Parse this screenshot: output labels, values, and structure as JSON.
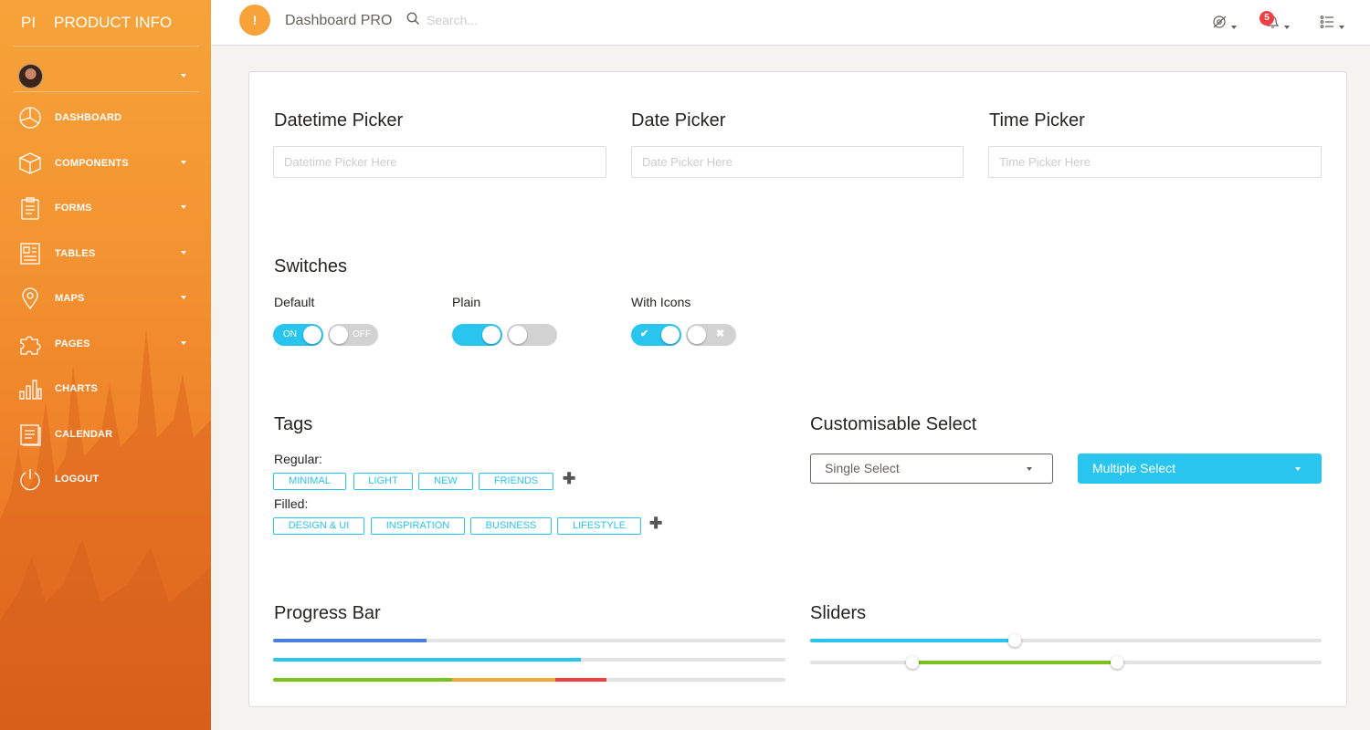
{
  "sidebar": {
    "logo_mini": "PI",
    "logo_full": "PRODUCT INFO",
    "items": [
      {
        "label": "DASHBOARD",
        "icon": "pie-chart-icon",
        "has_caret": false
      },
      {
        "label": "COMPONENTS",
        "icon": "box-icon",
        "has_caret": true
      },
      {
        "label": "FORMS",
        "icon": "clipboard-icon",
        "has_caret": true
      },
      {
        "label": "TABLES",
        "icon": "table-icon",
        "has_caret": true
      },
      {
        "label": "MAPS",
        "icon": "map-pin-icon",
        "has_caret": true
      },
      {
        "label": "PAGES",
        "icon": "puzzle-icon",
        "has_caret": true
      },
      {
        "label": "CHARTS",
        "icon": "bar-chart-icon",
        "has_caret": false
      },
      {
        "label": "CALENDAR",
        "icon": "calendar-icon",
        "has_caret": false
      },
      {
        "label": "LOGOUT",
        "icon": "power-icon",
        "has_caret": false
      }
    ]
  },
  "topbar": {
    "alert_symbol": "!",
    "brand": "Dashboard PRO",
    "search_placeholder": "Search...",
    "notification_count": "5"
  },
  "pickers": {
    "datetime": {
      "title": "Datetime Picker",
      "placeholder": "Datetime Picker Here"
    },
    "date": {
      "title": "Date Picker",
      "placeholder": "Date Picker Here"
    },
    "time": {
      "title": "Time Picker",
      "placeholder": "Time Picker Here"
    }
  },
  "switches": {
    "title": "Switches",
    "default_label": "Default",
    "plain_label": "Plain",
    "icons_label": "With Icons",
    "on_text": "ON",
    "off_text": "OFF",
    "check_symbol": "✔",
    "cross_symbol": "✖"
  },
  "tags": {
    "title": "Tags",
    "regular_label": "Regular:",
    "filled_label": "Filled:",
    "regular": [
      "MINIMAL",
      "LIGHT",
      "NEW",
      "FRIENDS"
    ],
    "filled": [
      "DESIGN & UI",
      "INSPIRATION",
      "BUSINESS",
      "LIFESTYLE"
    ],
    "add_symbol": "✚"
  },
  "select": {
    "title": "Customisable Select",
    "single": "Single Select",
    "multiple": "Multiple Select"
  },
  "progress": {
    "title": "Progress Bar",
    "bar1": 0.3,
    "bar2": 0.6,
    "bar3_segments": [
      0.35,
      0.2,
      0.1
    ],
    "colors": {
      "primary": "#4e7de2",
      "info": "#29c5ef",
      "success": "#7ac31e",
      "warning": "#f3a83b",
      "danger": "#ef3f45"
    }
  },
  "sliders": {
    "title": "Sliders",
    "single_value": 0.4,
    "range": [
      0.2,
      0.6
    ],
    "colors": {
      "single": "#29c5ef",
      "range": "#7ac31e"
    }
  }
}
